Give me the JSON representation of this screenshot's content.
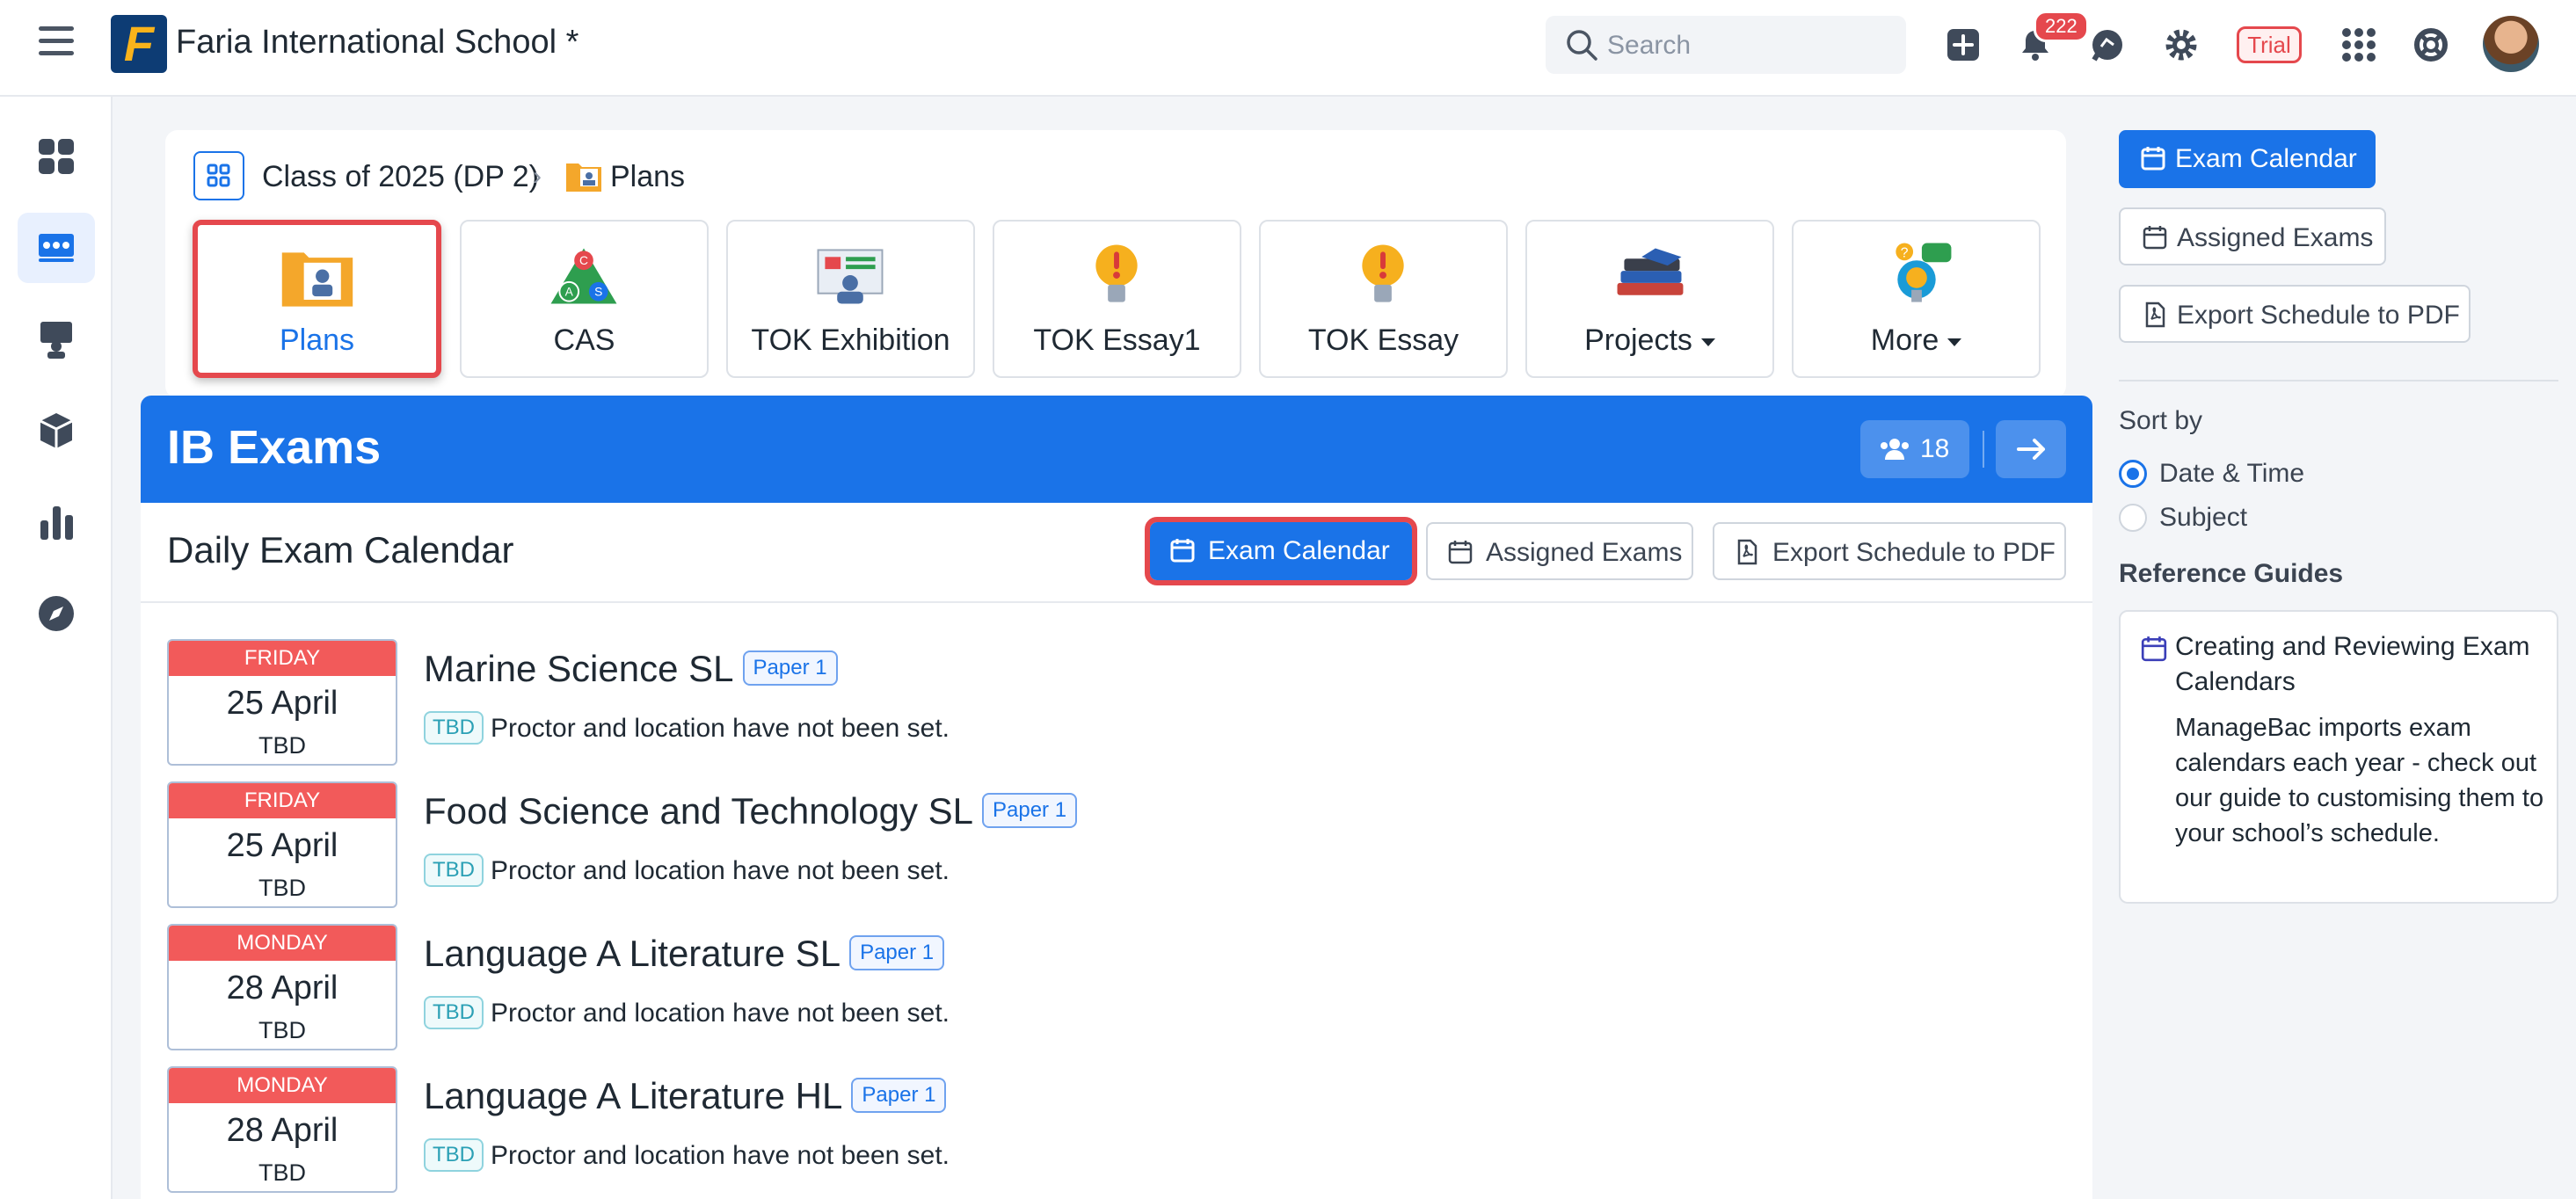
{
  "app": {
    "school_name": "Faria International School *"
  },
  "topbar": {
    "search_placeholder": "Search",
    "notification_count": "222",
    "trial_label": "Trial"
  },
  "breadcrumb": {
    "class": "Class of 2025 (DP 2)",
    "page": "Plans"
  },
  "tiles": [
    {
      "label": "Plans",
      "active": true
    },
    {
      "label": "CAS"
    },
    {
      "label": "TOK Exhibition"
    },
    {
      "label": "TOK Essay1"
    },
    {
      "label": "TOK Essay"
    },
    {
      "label": "Projects",
      "dropdown": true
    },
    {
      "label": "More",
      "dropdown": true
    }
  ],
  "banner": {
    "title": "IB Exams",
    "member_count": "18"
  },
  "panel": {
    "title": "Daily Exam Calendar",
    "exam_calendar_btn": "Exam Calendar",
    "assigned_exams_btn": "Assigned Exams",
    "export_btn": "Export Schedule to PDF"
  },
  "exams": [
    {
      "day": "FRIDAY",
      "date": "25 April",
      "time": "TBD",
      "name": "Marine Science  SL",
      "paper": "Paper 1",
      "tbd": "TBD",
      "note": "Proctor and location have not been set."
    },
    {
      "day": "FRIDAY",
      "date": "25 April",
      "time": "TBD",
      "name": "Food Science and Technology  SL",
      "paper": "Paper 1",
      "tbd": "TBD",
      "note": "Proctor and location have not been set."
    },
    {
      "day": "MONDAY",
      "date": "28 April",
      "time": "TBD",
      "name": "Language A Literature SL",
      "paper": "Paper 1",
      "tbd": "TBD",
      "note": "Proctor and location have not been set."
    },
    {
      "day": "MONDAY",
      "date": "28 April",
      "time": "TBD",
      "name": "Language A Literature HL",
      "paper": "Paper 1",
      "tbd": "TBD",
      "note": "Proctor and location have not been set."
    }
  ],
  "right": {
    "exam_calendar_btn": "Exam Calendar",
    "assigned_exams_btn": "Assigned Exams",
    "export_btn": "Export Schedule to PDF",
    "sort_heading": "Sort by",
    "sort_options": [
      "Date & Time",
      "Subject"
    ],
    "ref_heading": "Reference Guides",
    "ref_title": "Creating and Reviewing Exam Calendars",
    "ref_body": "ManageBac imports exam calendars each year - check out our guide to customising them to your school’s schedule."
  },
  "colors": {
    "accent": "#1a73e8",
    "danger": "#e5484d",
    "date_header": "#f25a5a"
  }
}
